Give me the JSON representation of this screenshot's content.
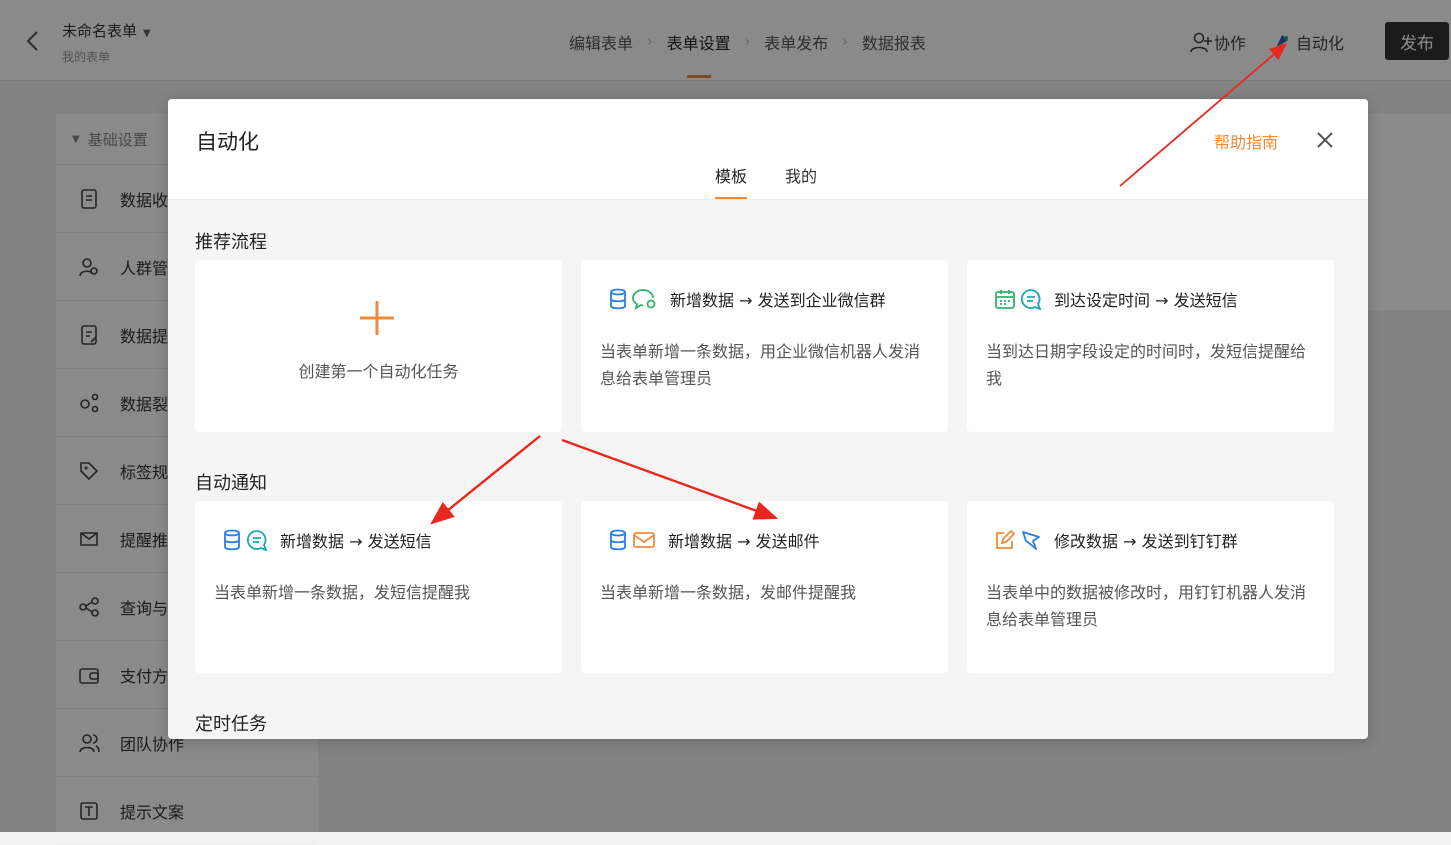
{
  "header": {
    "form_name": "未命名表单",
    "form_sub": "我的表单",
    "steps": [
      "编辑表单",
      "表单设置",
      "表单发布",
      "数据报表"
    ],
    "active_step": 1,
    "collab_label": "协作",
    "auto_label": "自动化",
    "publish_label": "发布"
  },
  "sidebar": {
    "group_label": "基础设置",
    "items": [
      {
        "label": "数据收",
        "icon": "document-icon"
      },
      {
        "label": "人群管",
        "icon": "people-icon"
      },
      {
        "label": "数据提",
        "icon": "edit-doc-icon"
      },
      {
        "label": "数据裂",
        "icon": "split-icon"
      },
      {
        "label": "标签规",
        "icon": "tag-icon"
      },
      {
        "label": "提醒推",
        "icon": "reminder-icon"
      },
      {
        "label": "查询与",
        "icon": "share-icon"
      },
      {
        "label": "支付方",
        "icon": "wallet-icon"
      },
      {
        "label": "团队协作",
        "icon": "team-icon"
      },
      {
        "label": "提示文案",
        "icon": "text-icon"
      }
    ]
  },
  "modal": {
    "title": "自动化",
    "help_label": "帮助指南",
    "tabs": [
      "模板",
      "我的"
    ],
    "sections": {
      "recommended": "推荐流程",
      "notify": "自动通知",
      "scheduled": "定时任务"
    },
    "create_label": "创建第一个自动化任务",
    "cards": [
      {
        "title": "新增数据 → 发送到企业微信群",
        "desc": "当表单新增一条数据，用企业微信机器人发消息给表单管理员"
      },
      {
        "title": "到达设定时间 → 发送短信",
        "desc": "当到达日期字段设定的时间时，发短信提醒给我"
      },
      {
        "title": "新增数据 → 发送短信",
        "desc": "当表单新增一条数据，发短信提醒我"
      },
      {
        "title": "新增数据 → 发送邮件",
        "desc": "当表单新增一条数据，发邮件提醒我"
      },
      {
        "title": "修改数据 → 发送到钉钉群",
        "desc": "当表单中的数据被修改时，用钉钉机器人发消息给表单管理员"
      }
    ]
  },
  "colors": {
    "accent": "#f08a3c",
    "annotation": "#e8281f",
    "db_blue": "#2a7ee0",
    "chat_green": "#2fb56a",
    "chat_teal": "#18a9a9"
  }
}
